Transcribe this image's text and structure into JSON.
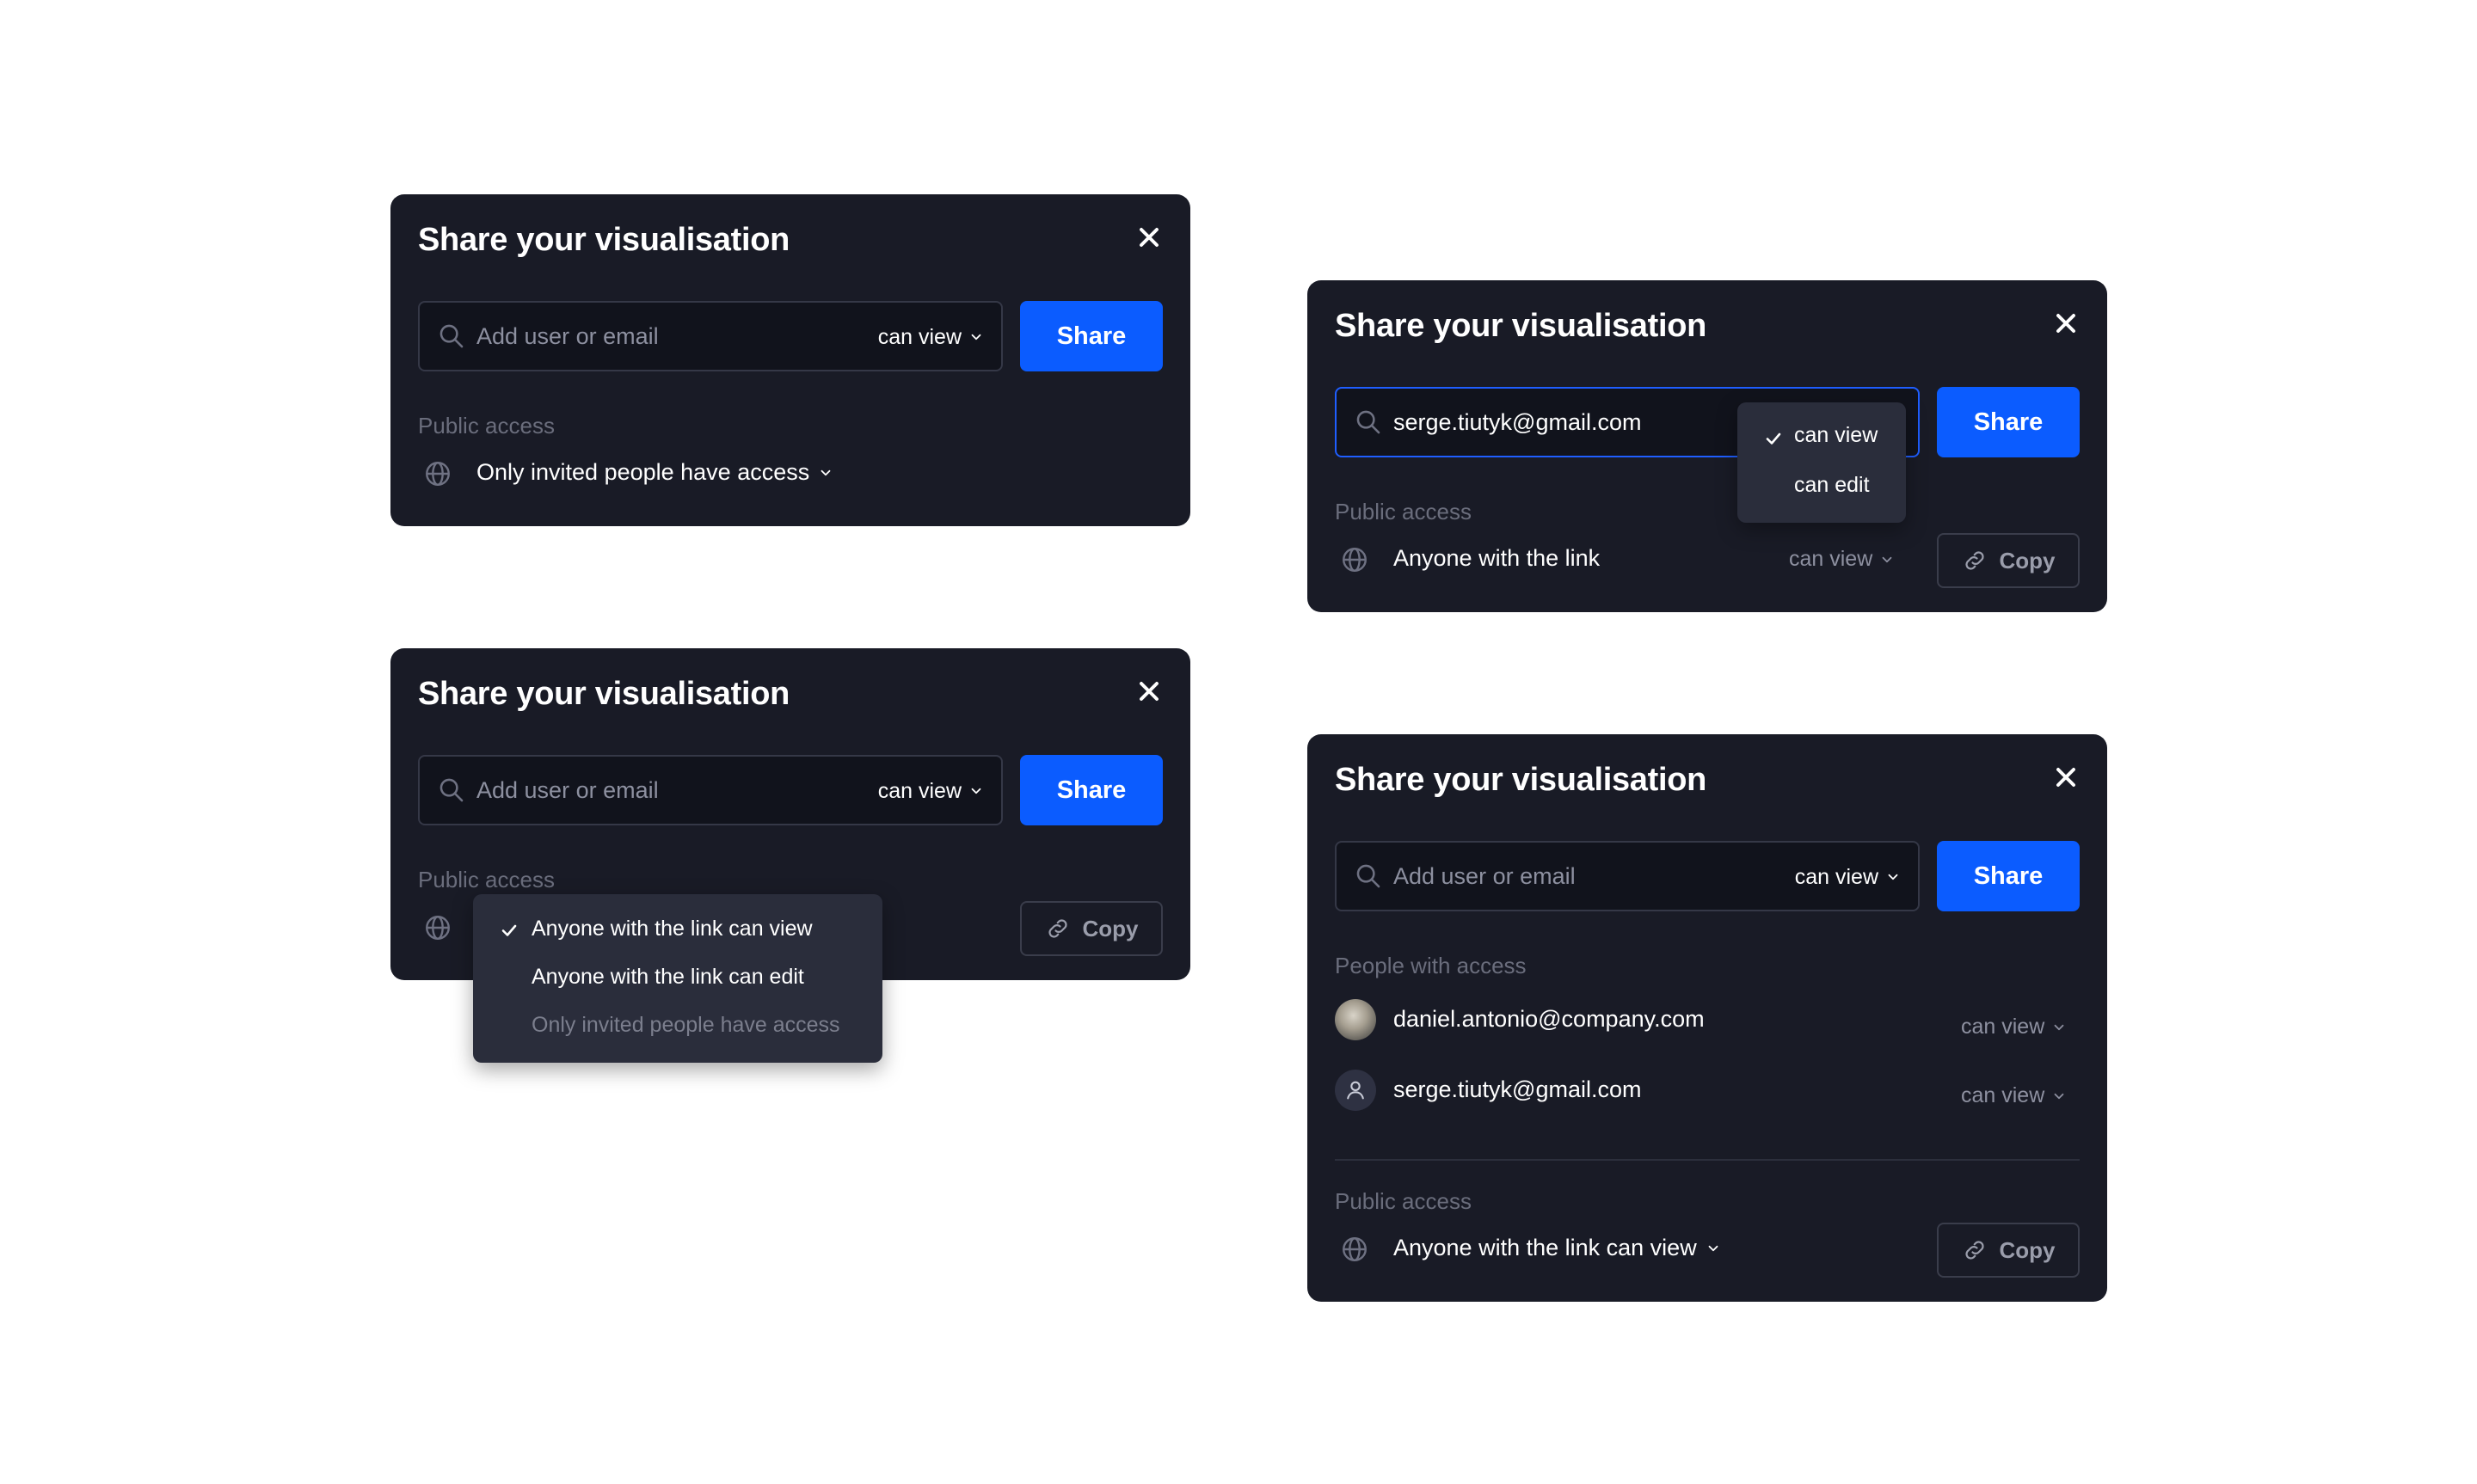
{
  "dialog_a": {
    "title": "Share your visualisation",
    "input_placeholder": "Add user or email",
    "permission": "can view",
    "share_label": "Share",
    "public_access_label": "Public access",
    "access_value": "Only invited people have access"
  },
  "dialog_b": {
    "title": "Share your visualisation",
    "input_placeholder": "Add user or email",
    "permission": "can view",
    "share_label": "Share",
    "public_access_label": "Public access",
    "copy_label": "Copy",
    "menu": [
      {
        "label": "Anyone with the link can view",
        "checked": true,
        "disabled": false
      },
      {
        "label": "Anyone with the link can edit",
        "checked": false,
        "disabled": false
      },
      {
        "label": "Only invited people have access",
        "checked": false,
        "disabled": true
      }
    ]
  },
  "dialog_c": {
    "title": "Share your visualisation",
    "input_value": "serge.tiutyk@gmail.com",
    "share_label": "Share",
    "public_access_label": "Public access",
    "access_value": "Anyone with the link",
    "access_permission": "can view",
    "copy_label": "Copy",
    "menu": [
      {
        "label": "can view",
        "checked": true
      },
      {
        "label": "can edit",
        "checked": false
      }
    ]
  },
  "dialog_d": {
    "title": "Share your visualisation",
    "input_placeholder": "Add user or email",
    "permission": "can view",
    "share_label": "Share",
    "people_label": "People with access",
    "people": [
      {
        "email": "daniel.antonio@company.com",
        "permission": "can view",
        "avatar": "photo"
      },
      {
        "email": "serge.tiutyk@gmail.com",
        "permission": "can view",
        "avatar": "user-icon"
      }
    ],
    "public_access_label": "Public access",
    "access_value": "Anyone with the link can view",
    "copy_label": "Copy"
  },
  "colors": {
    "dialog_bg": "#191b26",
    "primary": "#0b5cff",
    "focus_border": "#1f5eff",
    "muted_text": "#6a6d7c",
    "menu_bg": "#2a2d3b"
  }
}
